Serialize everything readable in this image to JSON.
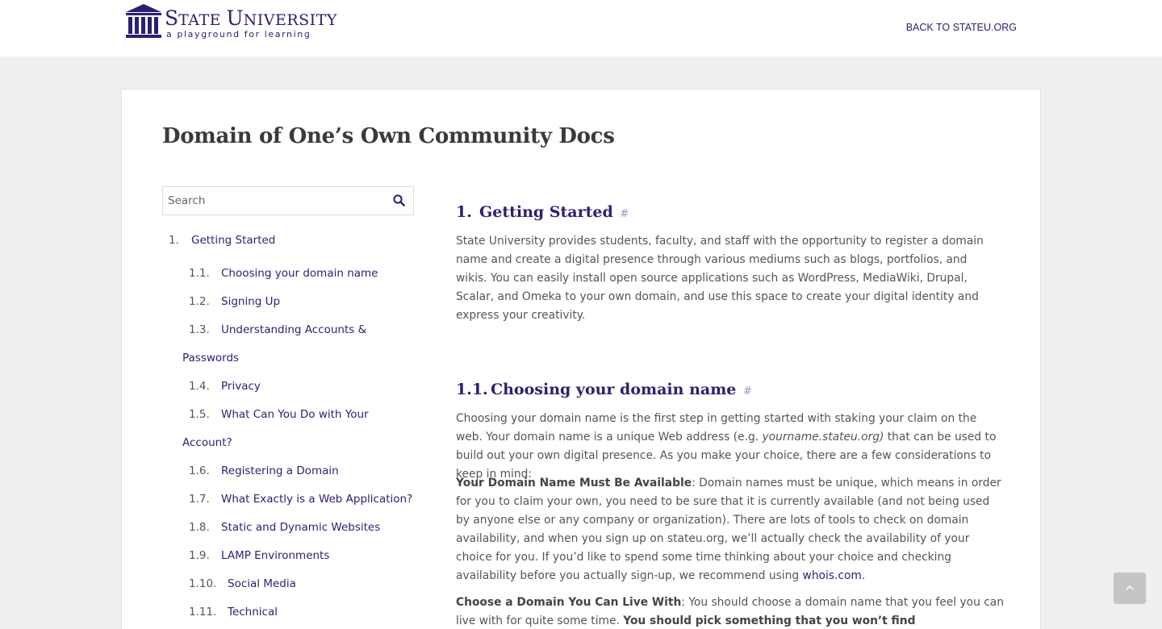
{
  "header": {
    "logo": {
      "title_first": "S",
      "title_rest_1": "TATE ",
      "title_second": "U",
      "title_rest_2": "NIVERSITY",
      "tagline": "a playground for learning",
      "icon": "building-columns-icon",
      "brand_color": "#2d1f70"
    },
    "back_link": "BACK TO STATEU.ORG"
  },
  "page": {
    "title": "Domain of One’s Own Community Docs"
  },
  "search": {
    "placeholder": "Search",
    "icon": "search-icon"
  },
  "toc": {
    "items": [
      {
        "num": "1.",
        "label": "Getting Started"
      },
      {
        "num": "1.1.",
        "label": "Choosing your domain name"
      },
      {
        "num": "1.2.",
        "label": "Signing Up"
      },
      {
        "num": "1.3.",
        "label": "Understanding Accounts & Passwords"
      },
      {
        "num": "1.4.",
        "label": "Privacy"
      },
      {
        "num": "1.5.",
        "label": "What Can You Do with Your Account?"
      },
      {
        "num": "1.6.",
        "label": "Registering a Domain"
      },
      {
        "num": "1.7.",
        "label": "What Exactly is a Web Application?"
      },
      {
        "num": "1.8.",
        "label": "Static and Dynamic Websites"
      },
      {
        "num": "1.9.",
        "label": "LAMP Environments"
      },
      {
        "num": "1.10.",
        "label": "Social Media"
      },
      {
        "num": "1.11.",
        "label": "Technical"
      }
    ]
  },
  "content": {
    "section1": {
      "num": "1.",
      "title": "Getting Started",
      "anchor": "#",
      "body": "State University provides students, faculty, and staff with the opportunity to register a domain name and create a digital presence through various mediums such as blogs, portfolios, and wikis. You can easily install open source applications such as WordPress, MediaWiki, Drupal, Scalar, and Omeka to your own domain, and use this space to create your digital identity and express your creativity."
    },
    "section11": {
      "num": "1.1.",
      "title": "Choosing your domain name",
      "anchor": "#",
      "intro_a": "Choosing your domain name is the first step in getting started with staking your claim on the web. Your domain name is a unique Web address (e.g. ",
      "intro_em": "yourname.stateu.org)",
      "intro_b": " that can be used to build out your own digital presence. As you make your choice, there are a few considerations to keep in mind:",
      "avail_label": "Your Domain Name Must Be Available",
      "avail_body": ": Domain names must be unique, which means in order for you to claim your own, you need to be sure that it is currently available (and not being used by anyone else or any company or organization). There are lots of tools to check on domain availability, and when you sign up on stateu.org, we’ll actually check the availability of your choice for you. If you’d like to spend some time thinking about your choice and checking availability before you actually sign-up, we recommend using ",
      "avail_link": "whois.com",
      "avail_end": ".",
      "live_label": "Choose a Domain You Can Live With",
      "live_body": ": You should choose a domain name that you feel you can live with for quite some time. ",
      "live_bold": "You should pick something that you won’t find embarrassing in the"
    }
  },
  "back_to_top": {
    "icon": "chevron-up-icon"
  }
}
